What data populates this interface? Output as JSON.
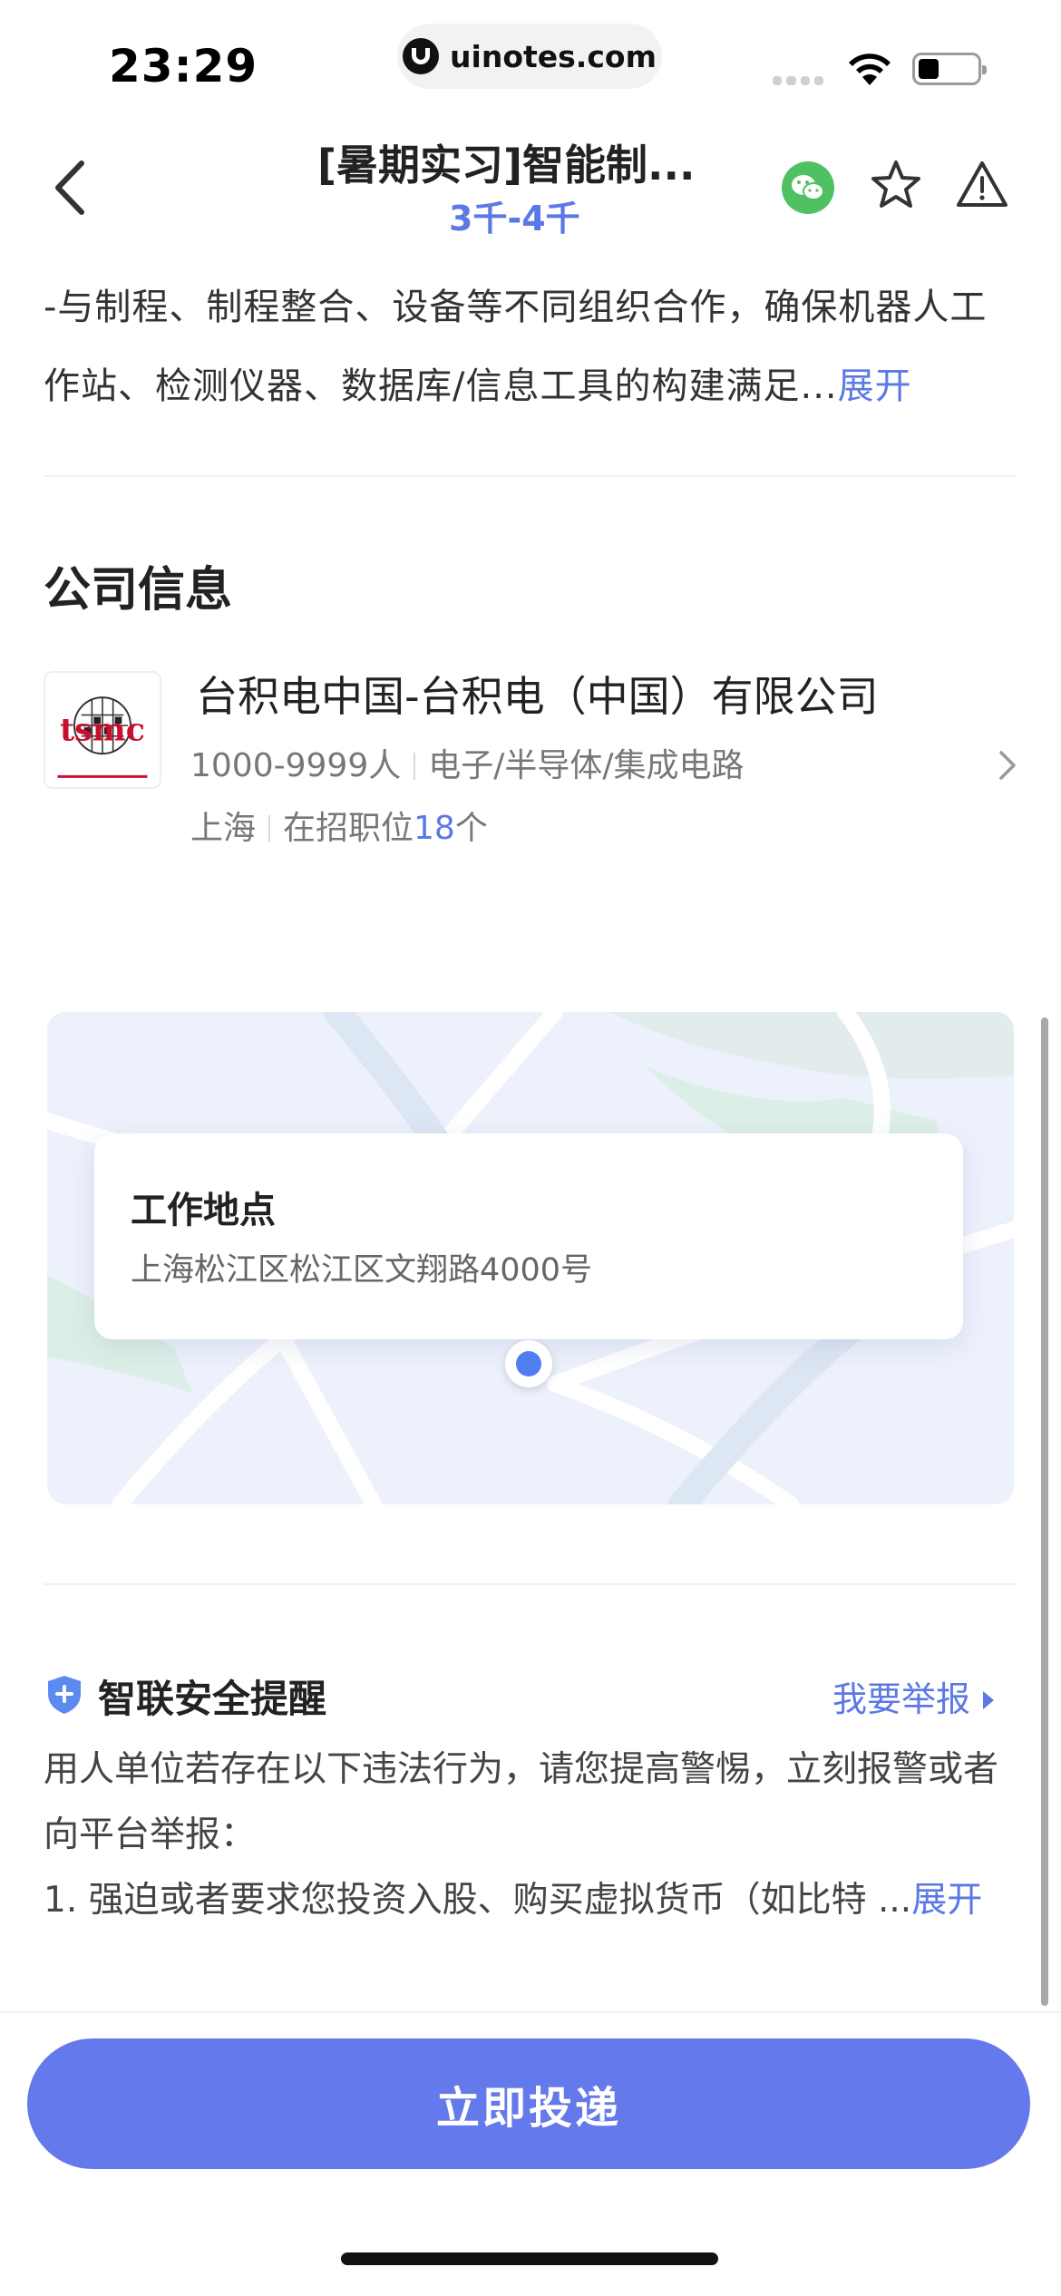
{
  "status_bar": {
    "time": "23:29",
    "url": "uinotes.com"
  },
  "header": {
    "title": "[暑期实习]智能制...",
    "salary": "3千-4千",
    "icons": [
      "back-icon",
      "wechat-icon",
      "star-icon",
      "warning-icon"
    ]
  },
  "description": {
    "text": "-与制程、制程整合、设备等不同组织合作，确保机器人工作站、检测仪器、数据库/信息工具的构建满足...",
    "expand_label": "展开"
  },
  "company_section": {
    "title": "公司信息",
    "logo_text": "tsmc",
    "name": "台积电中国-台积电（中国）有限公司",
    "size": "1000-9999人",
    "industry": "电子/半导体/集成电路",
    "city": "上海",
    "openings_prefix": "在招职位",
    "openings_count": "18",
    "openings_suffix": "个"
  },
  "location": {
    "title": "工作地点",
    "address": "上海松江区松江区文翔路4000号"
  },
  "safety": {
    "title": "智联安全提醒",
    "report_label": "我要举报",
    "line1": "用人单位若存在以下违法行为，请您提高警惕，立刻报警或者向平台举报：",
    "line2": "1. 强迫或者要求您投资入股、购买虚拟货币（如比特 ...",
    "expand_label": "展开"
  },
  "footer": {
    "apply_label": "立即投递"
  },
  "colors": {
    "accent": "#5b78e6",
    "button": "#6479eb",
    "wechat": "#4fc163",
    "tsmc_red": "#c8102e"
  }
}
